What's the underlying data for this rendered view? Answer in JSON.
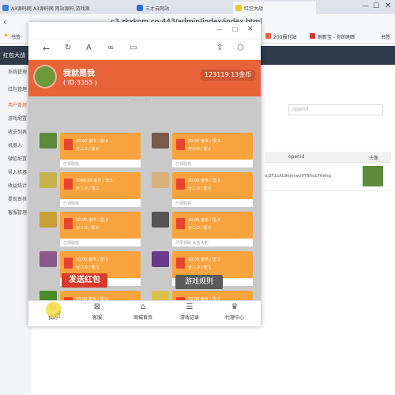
{
  "browser": {
    "tabs": [
      {
        "label": "A3源码网 A3源码网 网站源码,游戏源",
        "color": "#3b7de0"
      },
      {
        "label": "三才云网站",
        "color": "#2a6dd8"
      },
      {
        "label": "红包大战",
        "color": "#e9c63b",
        "active": true
      }
    ],
    "url": "c3.zkxkom.cn:443/admin/index/index.html",
    "bookmarks": [
      "书签",
      "200报刊站",
      "刷新宝 - 你的刷新",
      "书签"
    ]
  },
  "admin": {
    "title": "红包大战",
    "sidebar": [
      "系统管理",
      "红包管理",
      "用户管理",
      "游戏配置",
      "收支列表",
      "机器人",
      "微信配置",
      "导入机器",
      "收益统计",
      "提现审核",
      "客服管理"
    ],
    "search_placeholder": "openid",
    "table": {
      "header_openid": "openid",
      "header_avatar": "头像",
      "openid_value": "oj3F1sXL9ejmwv9Y8hoL76ehg"
    }
  },
  "popup": {
    "user_name": "我就是我",
    "user_id": "( ID:3355 )",
    "balance": "123119.13金币",
    "section_label": "<<<>>>",
    "cards": [
      {
        "amount": "20.00 金币 / 雷:0",
        "detail": "分:1.0 / 雷:0",
        "footer": "已领取完",
        "av": "#5a8a3a"
      },
      {
        "amount": "20.00 金币 / 雷:3",
        "detail": "分:0.0 / 雷:1",
        "footer": "已领取完",
        "av": "#7a5a4a"
      },
      {
        "amount": "1000.00 金币 / 雷:1",
        "detail": "分:1.0 / 雷:1",
        "footer": "已领取完",
        "av": "#c7b24d"
      },
      {
        "amount": "20.00 金币 / 雷:0",
        "detail": "分:1.0 / 雷:0",
        "footer": "已领取完",
        "av": "#d8b07a"
      },
      {
        "amount": "20.00 金币 / 雷:0",
        "detail": "分:1.0 / 雷:0",
        "footer": "已领取完",
        "av": "#c8a038"
      },
      {
        "amount": "20.00 金币 / 雷:0",
        "detail": "分:1.0 / 雷:0",
        "footer": "尽早领取 大吉大利",
        "av": "#555555"
      },
      {
        "amount": "10.00 金币 / 雷:1",
        "detail": "分:1.0 / 雷:1",
        "footer": "尽早领取 大吉大利",
        "av": "#8a5a8a"
      },
      {
        "amount": "20.00 金币 / 雷:1",
        "detail": "分:1.0 / 雷:1",
        "footer": "尽早领取 大吉大利",
        "av": "#6a3a8a"
      },
      {
        "amount": "10.00 金币 / 雷:1",
        "detail": "分:1.0 / 雷:1",
        "footer": "",
        "av": "#4a8a2a"
      },
      {
        "amount": "20.00 金币 / 雷:1",
        "detail": "分:1.0 / 雷:1",
        "footer": "",
        "av": "#d8c050"
      }
    ],
    "send_button": "发送红包",
    "rules_button": "游戏规则",
    "bottom_nav": [
      {
        "label": "我的",
        "icon": "user-icon"
      },
      {
        "label": "客服",
        "icon": "service-icon"
      },
      {
        "label": "商城首页",
        "icon": "shop-icon"
      },
      {
        "label": "游戏记录",
        "icon": "record-icon"
      },
      {
        "label": "代理中心",
        "icon": "crown-icon"
      }
    ]
  }
}
